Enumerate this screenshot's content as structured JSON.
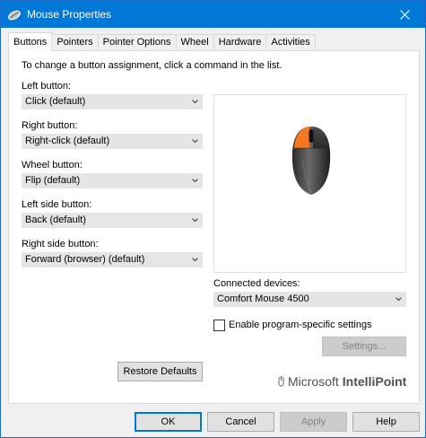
{
  "window": {
    "title": "Mouse Properties"
  },
  "tabs": [
    {
      "label": "Buttons",
      "active": true
    },
    {
      "label": "Pointers"
    },
    {
      "label": "Pointer Options"
    },
    {
      "label": "Wheel"
    },
    {
      "label": "Hardware"
    },
    {
      "label": "Activities"
    }
  ],
  "panel": {
    "instruction": "To change a button assignment, click a command in the list.",
    "left_button": {
      "label": "Left button:",
      "value": "Click (default)"
    },
    "right_button": {
      "label": "Right button:",
      "value": "Right-click (default)"
    },
    "wheel_button": {
      "label": "Wheel button:",
      "value": "Flip (default)"
    },
    "left_side_button": {
      "label": "Left side button:",
      "value": "Back (default)"
    },
    "right_side_button": {
      "label": "Right side button:",
      "value": "Forward (browser) (default)"
    },
    "connected_devices": {
      "label": "Connected devices:",
      "value": "Comfort Mouse 4500"
    },
    "program_specific": {
      "label": "Enable program-specific settings",
      "checked": false
    },
    "settings_button": "Settings...",
    "restore_defaults_button": "Restore Defaults",
    "brand": {
      "microsoft": "Microsoft",
      "product": "IntelliPoint"
    }
  },
  "footer": {
    "ok": "OK",
    "cancel": "Cancel",
    "apply": "Apply",
    "help": "Help"
  },
  "colors": {
    "titlebar": "#0078d7",
    "highlight": "#f47920"
  }
}
